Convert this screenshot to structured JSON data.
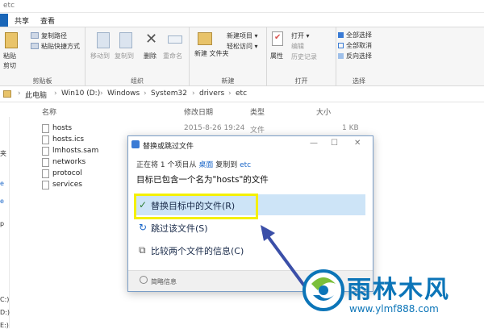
{
  "window": {
    "title": "etc"
  },
  "tabs": [
    "共享",
    "查看"
  ],
  "ribbon": {
    "clipboard": {
      "pin": "钉到\n快速访问",
      "copy": "复制",
      "paste": "粘贴",
      "copy_path": "复制路径",
      "paste_shortcut": "粘贴快捷方式",
      "cut": "剪切",
      "label": "剪贴板"
    },
    "organize": {
      "move_to": "移动到",
      "copy_to": "复制到",
      "delete": "删除",
      "rename": "重命名",
      "label": "组织"
    },
    "new": {
      "new_folder": "新建\n文件夹",
      "new_item": "新建项目 ▾",
      "easy_access": "轻松访问 ▾",
      "label": "新建"
    },
    "open": {
      "properties": "属性",
      "open": "打开 ▾",
      "edit": "编辑",
      "history": "历史记录",
      "label": "打开"
    },
    "select": {
      "select_all": "全部选择",
      "select_none": "全部取消",
      "invert": "反向选择",
      "label": "选择"
    }
  },
  "address": {
    "crumbs": [
      "此电脑",
      "Win10 (D:)",
      "Windows",
      "System32",
      "drivers",
      "etc"
    ]
  },
  "columns": {
    "name": "名称",
    "date": "修改日期",
    "type": "类型",
    "size": "大小"
  },
  "files": [
    {
      "name": "hosts",
      "date": "2015-8-26 19:24",
      "type": "文件",
      "size": "1 KB"
    },
    {
      "name": "hosts.ics",
      "date": "",
      "type": "",
      "size": ""
    },
    {
      "name": "lmhosts.sam",
      "date": "",
      "type": "",
      "size": ""
    },
    {
      "name": "networks",
      "date": "",
      "type": "",
      "size": ""
    },
    {
      "name": "protocol",
      "date": "",
      "type": "",
      "size": ""
    },
    {
      "name": "services",
      "date": "",
      "type": "",
      "size": ""
    }
  ],
  "leftpane": [
    "夹",
    "e",
    "e",
    "p",
    "C:)",
    "D:)",
    "E:)"
  ],
  "dialog": {
    "title": "替换或跳过文件",
    "line1_pre": "正在将 1 个项目从",
    "line1_src": "桌面",
    "line1_mid": "复制到",
    "line1_dst": "etc",
    "line2": "目标已包含一个名为\"hosts\"的文件",
    "opt_replace": "替换目标中的文件(R)",
    "opt_skip": "跳过该文件(S)",
    "opt_compare": "比较两个文件的信息(C)",
    "details": "简略信息"
  },
  "watermark": {
    "text": "雨林木风",
    "url": "www.ylmf888.com"
  },
  "colors": {
    "accent": "#1a66b8",
    "highlight": "#f4f000",
    "arrow": "#3b4fa8",
    "brand": "#0c75b8"
  }
}
